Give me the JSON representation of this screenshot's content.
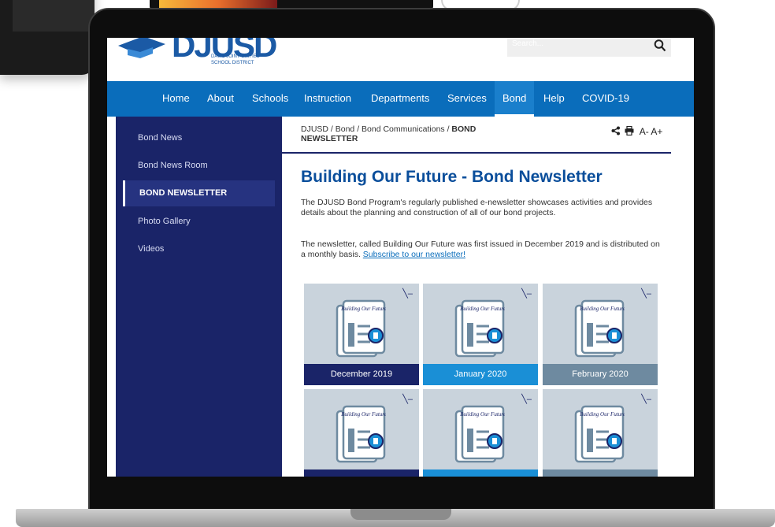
{
  "brand": {
    "name": "DJUSD",
    "sub1": "DAVIS JOINT UNIFIED",
    "sub2": "SCHOOL DISTRICT"
  },
  "search": {
    "placeholder": "Search..."
  },
  "nav": [
    "Home",
    "About",
    "Schools",
    "Instruction",
    "Departments",
    "Services",
    "Bond",
    "Help",
    "COVID-19"
  ],
  "nav_active": "Bond",
  "sidebar": {
    "items": [
      "Bond News",
      "Bond News Room",
      "BOND NEWSLETTER",
      "Photo Gallery",
      "Videos"
    ],
    "selected": "BOND NEWSLETTER"
  },
  "breadcrumb": {
    "line1": "DJUSD / Bond / Bond Communications / ",
    "current1": "BOND",
    "current2": "NEWSLETTER"
  },
  "tools": {
    "text_size": "A- A+"
  },
  "page": {
    "title": "Building Our Future - Bond Newsletter",
    "intro": "The DJUSD Bond Program's regularly published e-newsletter showcases activities and provides details about the planning and construction of all of our bond projects.",
    "para2": "The newsletter, called Building Our Future was first issued in December 2019 and is distributed on a monthly basis. ",
    "subscribe_link": "Subscribe to our newsletter!"
  },
  "cards": [
    {
      "label": "December 2019",
      "color": "#1a2468",
      "doc_text": "Building Our Future"
    },
    {
      "label": "January 2020",
      "color": "#1a8fd6",
      "doc_text": "Building Our Future"
    },
    {
      "label": "February 2020",
      "color": "#6e8aa0",
      "doc_text": "Building Our Future"
    },
    {
      "label": "",
      "color": "#1a2468",
      "doc_text": "Building Our Future"
    },
    {
      "label": "",
      "color": "#1a8fd6",
      "doc_text": "Building Our Future"
    },
    {
      "label": "",
      "color": "#6e8aa0",
      "doc_text": "Building Our Future"
    }
  ],
  "colors": {
    "nav": "#0a6dbb",
    "sidebar": "#1a2468",
    "title": "#0a4e9b"
  }
}
